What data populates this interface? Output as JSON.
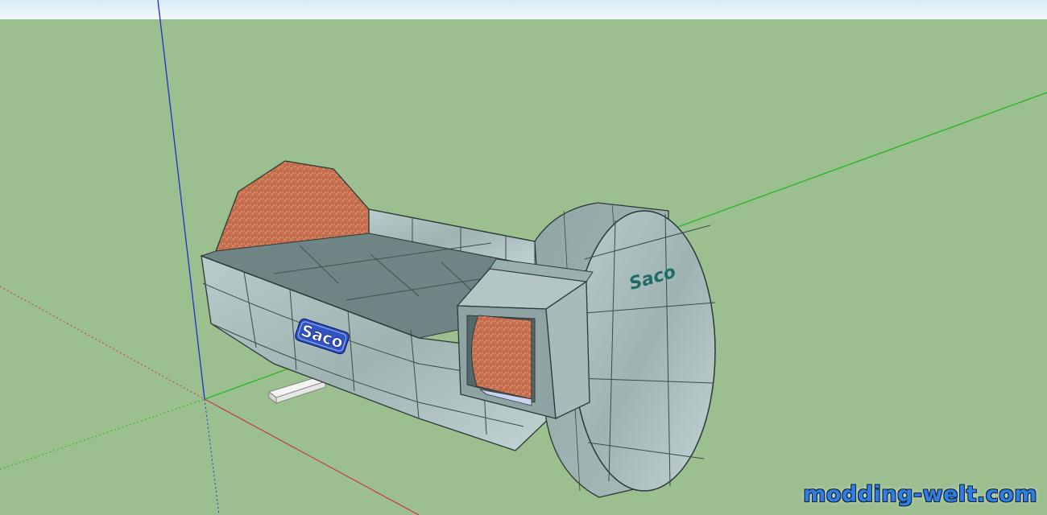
{
  "scene": {
    "sky_color": "#e6f2fb",
    "ground_color": "#9bbf8f",
    "axis_colors": {
      "blue": "#1e2fd0",
      "green": "#1fb51f",
      "red": "#c73a3a"
    },
    "model": {
      "tile_color": "#a9bcbc",
      "tile_dark": "#7e9292",
      "floor_color": "#6d8383",
      "fill_color": "#c8714e",
      "rail_color": "#ffffff"
    },
    "logos": {
      "side_logo": "Saco",
      "front_logo": "Saco"
    }
  },
  "watermark": {
    "text": "modding-welt.com"
  }
}
